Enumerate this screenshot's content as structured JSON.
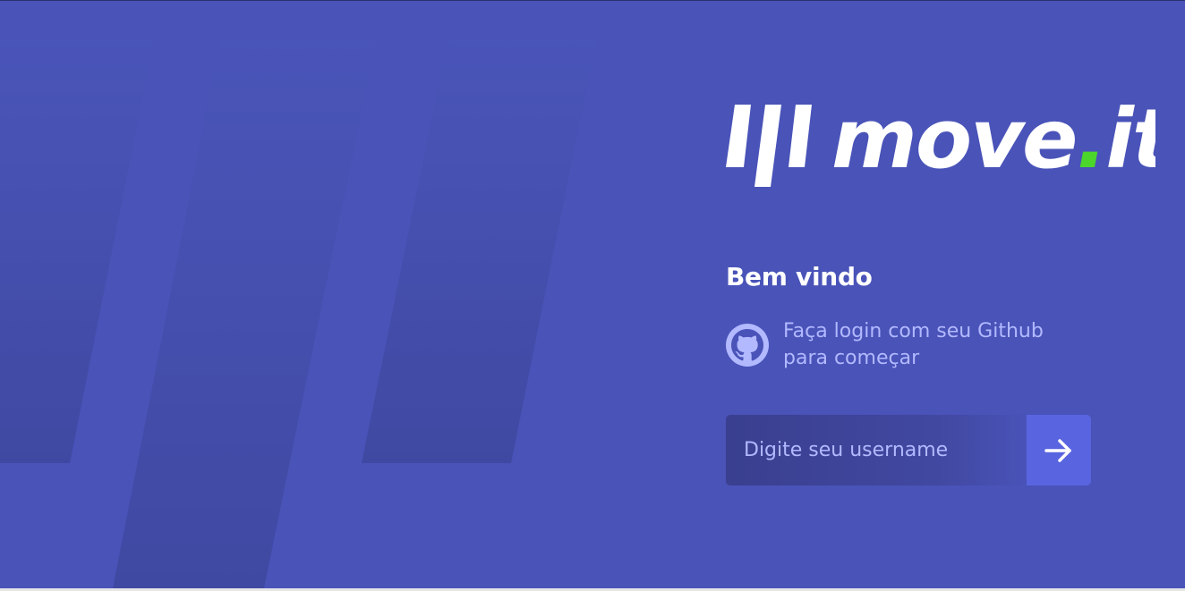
{
  "logo": {
    "wordmark_main": "move",
    "wordmark_dot": ".",
    "wordmark_suffix": "it",
    "dot_color": "#4cd62b"
  },
  "login": {
    "title": "Bem vindo",
    "description": "Faça login com seu Github para começar",
    "github_icon": "github-icon",
    "username_placeholder": "Digite seu username",
    "username_value": "",
    "submit_icon": "arrow-right-icon"
  },
  "colors": {
    "background": "#4953b8",
    "text_primary": "#ffffff",
    "text_secondary": "#b2b9ff",
    "button": "#5965e0"
  }
}
